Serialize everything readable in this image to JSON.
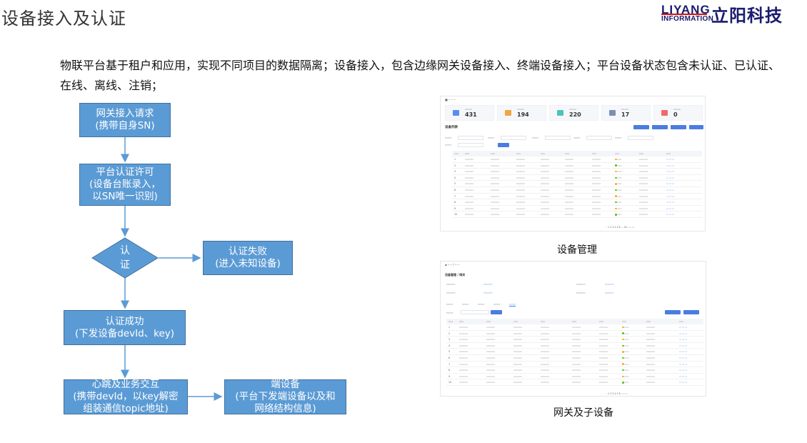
{
  "page": {
    "title": "设备接入及认证",
    "intro": "物联平台基于租户和应用，实现不同项目的数据隔离；设备接入，包含边缘网关设备接入、终端设备接入；平台设备状态包含未认证、已认证、在线、离线、注销；"
  },
  "logo": {
    "brand": "LIYANG",
    "sub": "INFORMATION",
    "cn": "立阳科技"
  },
  "flow": {
    "step1": [
      "网关接入请求",
      "(携带自身SN)"
    ],
    "step2": [
      "平台认证许可",
      "(设备台账录入，",
      "以SN唯一识别)"
    ],
    "decision": [
      "认",
      "证"
    ],
    "fail": [
      "认证失败",
      "(进入未知设备)"
    ],
    "success": [
      "认证成功",
      "(下发设备devId、key)"
    ],
    "heartbeat": [
      "心跳及业务交互",
      "(携带devId，以key解密",
      "组装通信topic地址)"
    ],
    "endpoint": [
      "端设备",
      "(平台下发端设备以及和",
      "网络结构信息)"
    ]
  },
  "screenshot1": {
    "caption": "设备管理",
    "stats": [
      {
        "value": "431",
        "color": "#5b8def"
      },
      {
        "value": "194",
        "color": "#f2a541"
      },
      {
        "value": "220",
        "color": "#4cc3b8"
      },
      {
        "value": "17",
        "color": "#7a8fb5"
      },
      {
        "value": "0",
        "color": "#ee6b6b"
      }
    ],
    "section": "设备列表"
  },
  "screenshot2": {
    "caption": "网关及子设备",
    "title": "设备管理 / 网关"
  }
}
